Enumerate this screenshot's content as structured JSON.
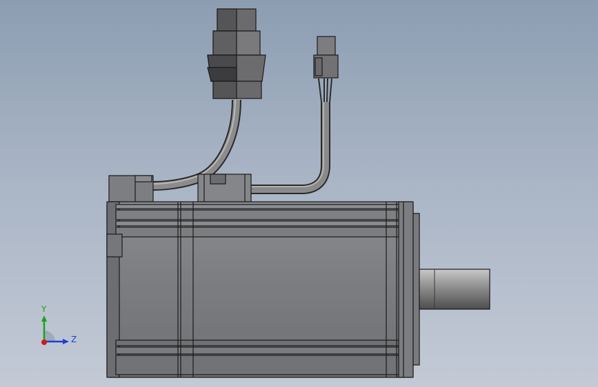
{
  "scene": {
    "colors": {
      "background_top": "#8c9db2",
      "background_bottom": "#c3cad6",
      "body_gray": "#7a7b7e",
      "edge": "#1a1a1a"
    }
  },
  "triad": {
    "y_label": "Y",
    "z_label": "Z",
    "colors": {
      "y": "#19a319",
      "z": "#1c3fd8",
      "x": "#d11a1a"
    }
  }
}
